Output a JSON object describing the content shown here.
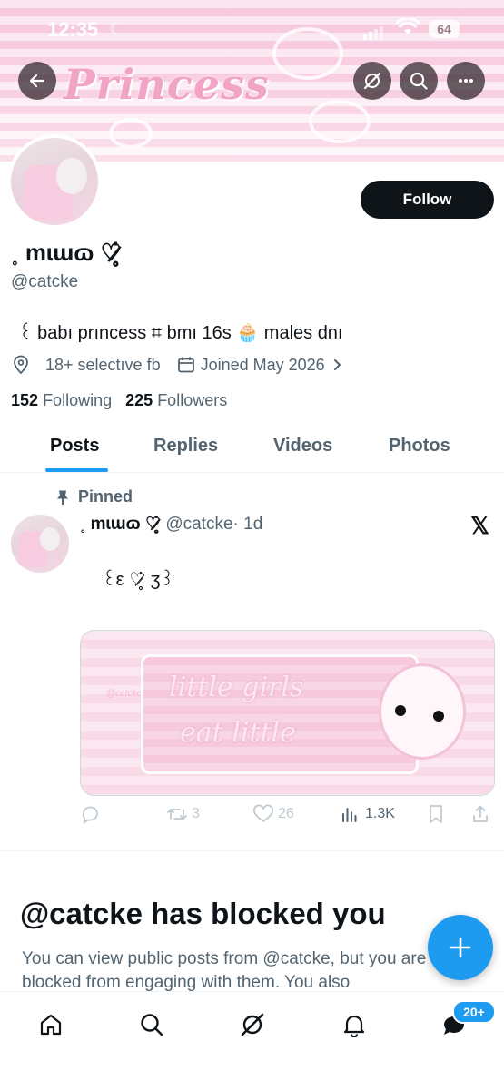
{
  "status_bar": {
    "time": "12:35",
    "battery": "64"
  },
  "header": {
    "banner_text": "Princess"
  },
  "profile": {
    "display_name": "˳ mɩɯɷ ♡̷̥̇",
    "handle": "@catcke",
    "follow_label": "Follow",
    "bio": "꒰ babı  prıncess  ⌗  bmı 16s  🧁  males dnı",
    "location": "18+  selectıve fb",
    "joined": "Joined May 2026",
    "following_count": "152",
    "following_label": "Following",
    "followers_count": "225",
    "followers_label": "Followers"
  },
  "tabs": [
    {
      "label": "Posts",
      "active": true
    },
    {
      "label": "Replies",
      "active": false
    },
    {
      "label": "Videos",
      "active": false
    },
    {
      "label": "Photos",
      "active": false
    }
  ],
  "post": {
    "pinned_label": "Pinned",
    "author_name": "˳ mɩɯɷ ♡̷̥̇",
    "author_handle": "@catcke",
    "time": "· 1d",
    "text": "꒰ε ♡̷̥̇ ʒ꒱",
    "media_line1": "little girls",
    "media_line2": "eat little",
    "media_watermark": "@catcke",
    "retweets": "3",
    "likes": "26",
    "views": "1.3K"
  },
  "blocked": {
    "title": "@catcke has blocked you",
    "text": "You can view public posts from @catcke, but you are blocked from engaging with them. You also"
  },
  "nav": {
    "messages_badge": "20+"
  },
  "icons": [
    "back-arrow-icon",
    "grok-icon",
    "search-icon",
    "more-icon",
    "location-icon",
    "calendar-icon",
    "chevron-right-icon",
    "pin-icon",
    "x-logo-icon",
    "reply-icon",
    "retweet-icon",
    "like-icon",
    "views-icon",
    "bookmark-icon",
    "share-icon",
    "plus-icon",
    "home-icon",
    "notifications-icon",
    "messages-icon"
  ],
  "colors": {
    "accent": "#1d9bf0",
    "text": "#0f1419",
    "secondary": "#536471",
    "banner_pink": "#f6c6dc"
  }
}
